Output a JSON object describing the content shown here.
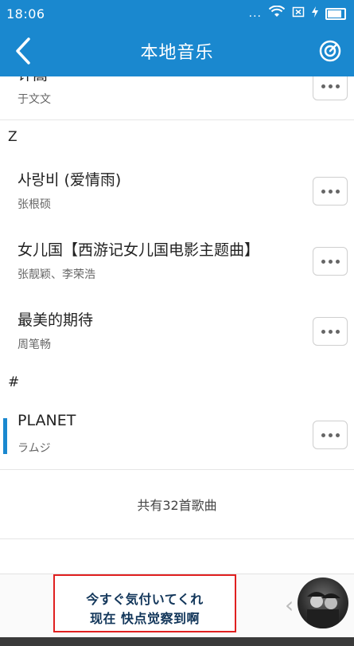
{
  "status_bar": {
    "time": "18:06",
    "dots": "..."
  },
  "header": {
    "title": "本地音乐"
  },
  "list": {
    "partial_row": {
      "song": "许嵩",
      "artist": "于文文"
    },
    "sections": [
      {
        "letter": "Z"
      },
      {
        "letter": "#"
      }
    ],
    "songs": [
      {
        "song": "사랑비 (爱情雨)",
        "artist": "张根硕"
      },
      {
        "song": "女儿国【西游记女儿国电影主题曲】",
        "artist": "张靓颖、李荣浩"
      },
      {
        "song": "最美的期待",
        "artist": "周笔畅"
      },
      {
        "song": "PLANET",
        "artist": "ラムジ",
        "playing": true
      }
    ],
    "total": "共有32首歌曲"
  },
  "player": {
    "lyric_line_1": "今すぐ気付いてくれ",
    "lyric_line_2": "现在 快点觉察到啊"
  },
  "colors": {
    "accent": "#1a88cf",
    "highlight_border": "#e02020"
  }
}
